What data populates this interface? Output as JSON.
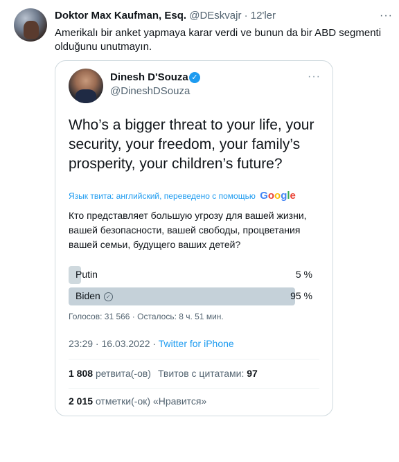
{
  "tweet": {
    "author_name": "Doktor Max Kaufman, Esq.",
    "author_handle": "@DEskvajr",
    "separator": "·",
    "time": "12'ler",
    "more": "···",
    "text": "Amerikalı bir anket yapmaya karar verdi ve bunun da bir ABD segmenti olduğunu unutmayın."
  },
  "quote": {
    "name": "Dinesh D'Souza",
    "handle": "@DineshDSouza",
    "verified_icon": "verified-badge-icon",
    "more": "···",
    "question": "Who’s a bigger threat to your life, your security, your freedom, your family’s prosperity, your children’s future?",
    "translate_label": "Язык твита: английский, переведено с помощью",
    "translate_brand": [
      "G",
      "o",
      "o",
      "g",
      "l",
      "e"
    ],
    "translated_text": "Кто представляет большую угрозу для вашей жизни, вашей безопасности, вашей свободы, процветания вашей семьи, будущего ваших детей?",
    "poll": {
      "options": [
        {
          "label": "Putin",
          "percent_label": "5 %",
          "percent": 5,
          "winner": false
        },
        {
          "label": "Biden",
          "percent_label": "95 %",
          "percent": 95,
          "winner": true
        }
      ],
      "meta": "Голосов: 31 566 · Осталось: 8 ч. 51 мин."
    },
    "timestamp": "23:29 · 16.03.2022 ·",
    "source": "Twitter for iPhone",
    "retweets_count": "1 808",
    "retweets_label": "ретвита(-ов)",
    "quotes_label": "Твитов с цитатами:",
    "quotes_count": "97",
    "likes_count": "2 015",
    "likes_label": "отметки(-ок) «Нравится»"
  },
  "colors": {
    "accent": "#1d9bf0",
    "secondary_text": "#536471",
    "poll_bar": "#cfd9de"
  }
}
